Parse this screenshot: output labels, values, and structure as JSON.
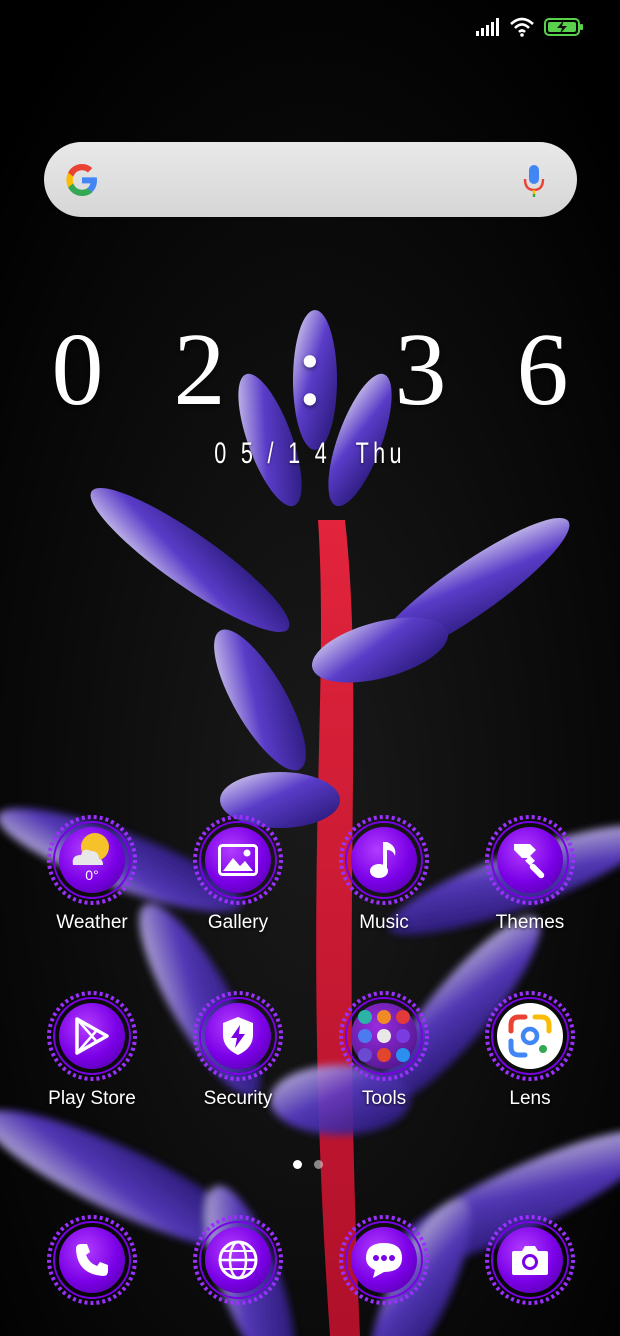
{
  "clock": {
    "time": "0 2 : 3 6",
    "date": "0 5 / 1 4",
    "day": "Thu"
  },
  "weather": {
    "temperature": "0°"
  },
  "apps": [
    {
      "label": "Weather"
    },
    {
      "label": "Gallery"
    },
    {
      "label": "Music"
    },
    {
      "label": "Themes"
    },
    {
      "label": "Play Store"
    },
    {
      "label": "Security"
    },
    {
      "label": "Tools"
    },
    {
      "label": "Lens"
    }
  ],
  "dock": [
    {
      "icon": "phone-icon"
    },
    {
      "icon": "browser-icon"
    },
    {
      "icon": "messages-icon"
    },
    {
      "icon": "camera-icon"
    }
  ],
  "page_indicator": {
    "pages": 2,
    "current": 1
  },
  "colors": {
    "accent": "#7a00e6",
    "ring": "#9b30ff"
  }
}
